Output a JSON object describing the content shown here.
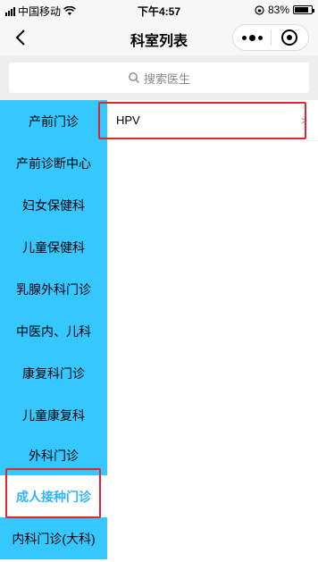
{
  "status_bar": {
    "carrier": "中国移动",
    "time": "下午4:57",
    "battery": "83%"
  },
  "nav": {
    "title": "科室列表"
  },
  "search": {
    "placeholder": "搜索医生"
  },
  "sidebar": {
    "items": [
      {
        "label": "产前门诊"
      },
      {
        "label": "产前诊断中心"
      },
      {
        "label": "妇女保健科"
      },
      {
        "label": "儿童保健科"
      },
      {
        "label": "乳腺外科门诊"
      },
      {
        "label": "中医内、儿科"
      },
      {
        "label": "康复科门诊"
      },
      {
        "label": "儿童康复科"
      },
      {
        "label": "外科门诊"
      },
      {
        "label": "成人接种门诊",
        "selected": true
      },
      {
        "label": "内科门诊(大科)"
      }
    ]
  },
  "content": {
    "items": [
      {
        "label": "HPV",
        "arrow": ">"
      }
    ]
  },
  "colors": {
    "sidebar_bg": "#35c7ff",
    "selected_text": "#2fb4ff",
    "highlight": "#e0262a"
  }
}
